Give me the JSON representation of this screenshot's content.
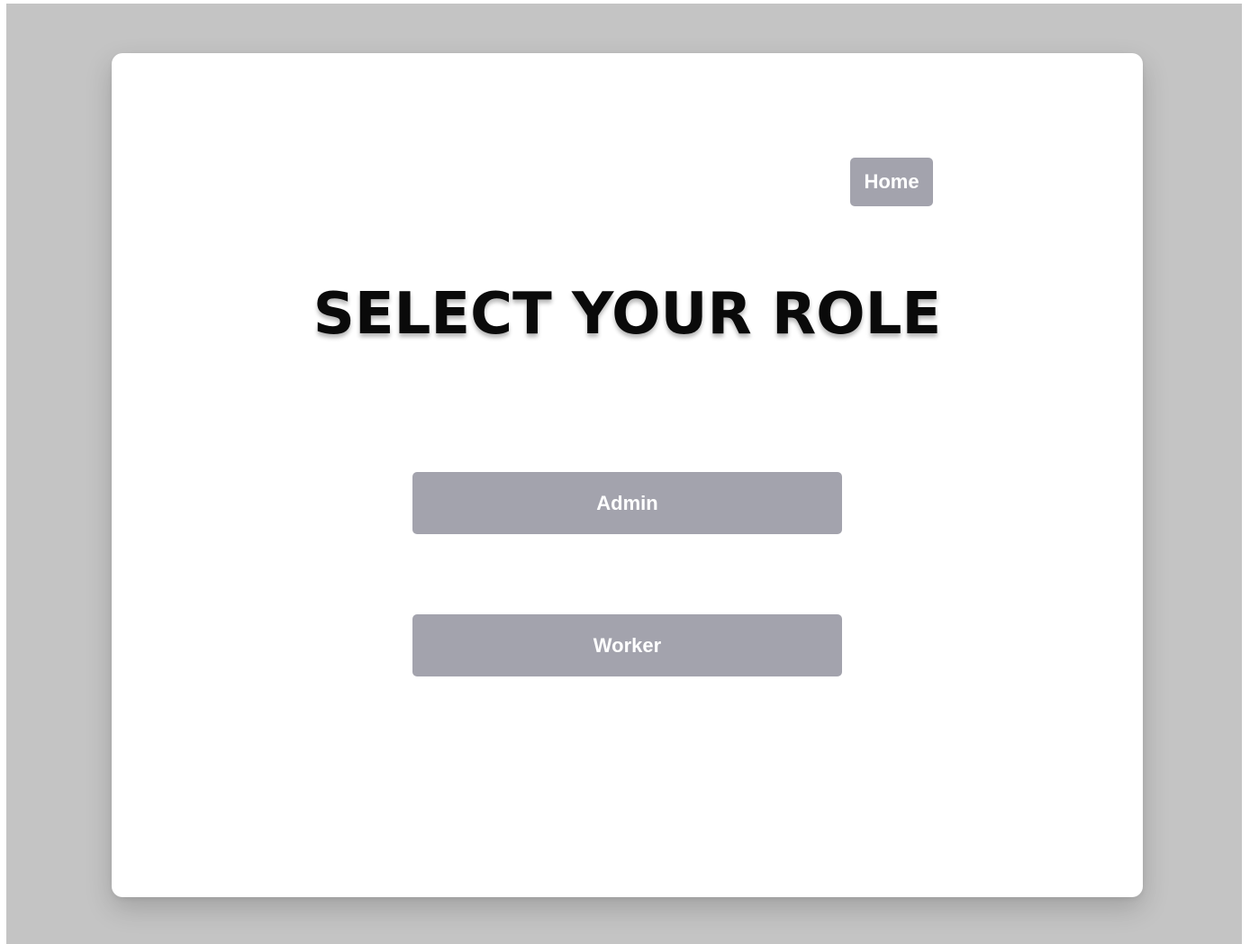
{
  "nav": {
    "home_label": "Home"
  },
  "page": {
    "title": "SELECT YOUR ROLE"
  },
  "roles": {
    "admin_label": "Admin",
    "worker_label": "Worker"
  },
  "colors": {
    "backdrop": "#c4c4c4",
    "card": "#ffffff",
    "button": "#a3a3ad",
    "button_text": "#ffffff",
    "title_text": "#0a0a0a"
  }
}
